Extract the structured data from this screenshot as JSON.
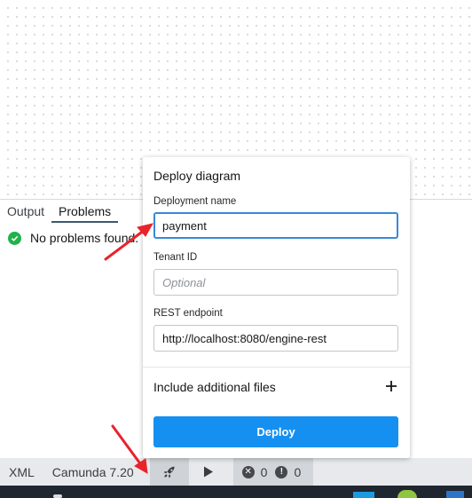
{
  "panel": {
    "tabs": [
      {
        "label": "Output",
        "active": false
      },
      {
        "label": "Problems",
        "active": true
      }
    ],
    "problems_message": "No problems found."
  },
  "dialog": {
    "title": "Deploy diagram",
    "deployment_name": {
      "label": "Deployment name",
      "value": "payment"
    },
    "tenant_id": {
      "label": "Tenant ID",
      "value": "",
      "placeholder": "Optional"
    },
    "rest_endpoint": {
      "label": "REST endpoint",
      "value": "http://localhost:8080/engine-rest"
    },
    "additional_files_label": "Include additional files",
    "deploy_label": "Deploy"
  },
  "statusbar": {
    "xml_label": "XML",
    "engine_label": "Camunda 7.20",
    "errors_count": "0",
    "warnings_count": "0"
  },
  "colors": {
    "accent": "#1590f1",
    "focus": "#3889d9",
    "success": "#22b24c",
    "annotation": "#e8232c"
  },
  "icons": [
    "check-icon",
    "rocket-icon",
    "play-icon",
    "error-icon",
    "warning-icon",
    "plus-icon",
    "arrow-annotation"
  ]
}
